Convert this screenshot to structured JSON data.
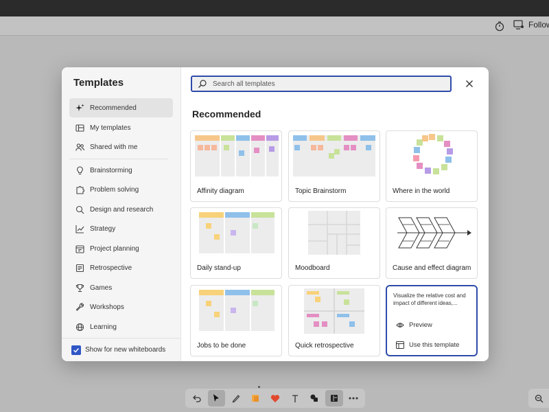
{
  "appbar": {
    "follow_label": "Follow"
  },
  "dialog": {
    "title": "Templates",
    "search_placeholder": "Search all templates",
    "section_title": "Recommended",
    "show_for_new_label": "Show for new whiteboards"
  },
  "sidebar": {
    "items": [
      {
        "label": "Recommended",
        "icon": "sparkle-icon"
      },
      {
        "label": "My templates",
        "icon": "template-icon"
      },
      {
        "label": "Shared with me",
        "icon": "people-icon"
      },
      {
        "label": "Brainstorming",
        "icon": "lightbulb-icon"
      },
      {
        "label": "Problem solving",
        "icon": "puzzle-icon"
      },
      {
        "label": "Design and research",
        "icon": "search-icon"
      },
      {
        "label": "Strategy",
        "icon": "chart-line-icon"
      },
      {
        "label": "Project planning",
        "icon": "calendar-icon"
      },
      {
        "label": "Retrospective",
        "icon": "history-icon"
      },
      {
        "label": "Games",
        "icon": "trophy-icon"
      },
      {
        "label": "Workshops",
        "icon": "wrench-icon"
      },
      {
        "label": "Learning",
        "icon": "globe-icon"
      }
    ]
  },
  "templates": [
    {
      "label": "Affinity diagram"
    },
    {
      "label": "Topic Brainstorm"
    },
    {
      "label": "Where in the world"
    },
    {
      "label": "Daily stand-up"
    },
    {
      "label": "Moodboard"
    },
    {
      "label": "Cause and effect diagram"
    },
    {
      "label": "Jobs to be done"
    },
    {
      "label": "Quick retrospective"
    },
    {
      "label": "",
      "description": "Visualize the relative cost and impact of different ideas,...",
      "preview_label": "Preview",
      "use_label": "Use this template"
    }
  ],
  "colors": {
    "accent": "#2f4ba8",
    "note_orange": "#f6c68b",
    "note_pink": "#e48fc3",
    "note_green": "#c8e29a",
    "note_blue": "#8fc0ea",
    "note_purple": "#b79be6",
    "note_yellow": "#f8d27a"
  }
}
